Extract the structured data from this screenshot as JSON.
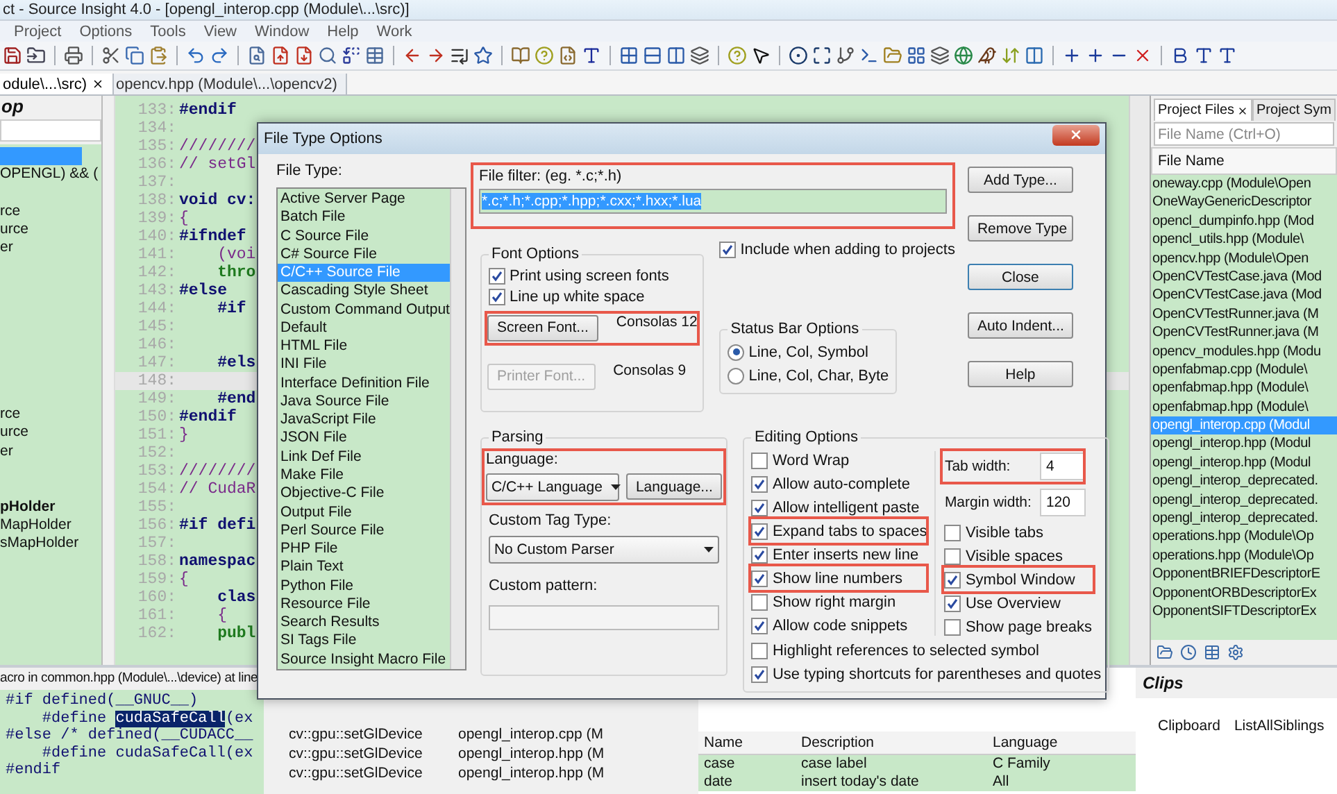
{
  "window": {
    "title": "ct - Source Insight 4.0 - [opengl_interop.cpp (Module\\...\\src)]"
  },
  "menu": [
    "Project",
    "Options",
    "Tools",
    "View",
    "Window",
    "Help",
    "Work"
  ],
  "tabs": [
    {
      "label": "odule\\...\\src)",
      "selected": true,
      "closable": true
    },
    {
      "label": "opencv.hpp (Module\\...\\opencv2)",
      "selected": false,
      "closable": false
    }
  ],
  "symbol_panel": {
    "title": "op",
    "items": [
      {
        "selected": true
      },
      {
        "text": "OPENGL) && (",
        "selected": false,
        "bold": false
      },
      {
        "selected": false
      },
      {
        "text": "rce",
        "selected": false,
        "bold": false
      },
      {
        "text": "urce",
        "selected": false,
        "bold": false
      },
      {
        "text": "er",
        "selected": false,
        "bold": false
      },
      {
        "selected": false
      },
      {
        "selected": false
      },
      {
        "selected": false
      },
      {
        "selected": false
      },
      {
        "selected": false
      },
      {
        "selected": false
      },
      {
        "selected": false
      },
      {
        "selected": false
      },
      {
        "text": "rce",
        "selected": false,
        "bold": false
      },
      {
        "text": "urce",
        "selected": false,
        "bold": false
      },
      {
        "text": "er",
        "selected": false,
        "bold": false
      },
      {
        "selected": false
      },
      {
        "selected": false
      },
      {
        "text": "pHolder",
        "selected": false,
        "bold": true
      },
      {
        "text": "MapHolder",
        "selected": false,
        "bold": false
      },
      {
        "text": "sMapHolder",
        "selected": false,
        "bold": false
      }
    ]
  },
  "editor": {
    "lines": [
      {
        "number": "133:",
        "text": "#endif",
        "kind": "directive",
        "current": false
      },
      {
        "number": "134:",
        "current": false
      },
      {
        "number": "135:",
        "text": "////////",
        "kind": "comment",
        "current": false
      },
      {
        "number": "136:",
        "text": "// setGl",
        "kind": "comment",
        "current": false
      },
      {
        "number": "137:",
        "current": false
      },
      {
        "number": "138:",
        "text": "void cv:",
        "kind": "declaration",
        "current": false
      },
      {
        "number": "139:",
        "text": "{",
        "kind": "brace",
        "current": false
      },
      {
        "number": "140:",
        "text": "#ifndef",
        "kind": "directive",
        "current": false
      },
      {
        "number": "141:",
        "text": "    (voi",
        "kind": "comment",
        "current": false
      },
      {
        "number": "142:",
        "text": "    thro",
        "kind": "keyword",
        "current": false
      },
      {
        "number": "143:",
        "text": "#else",
        "kind": "directive",
        "current": false
      },
      {
        "number": "144:",
        "text": "    #if",
        "kind": "directive",
        "current": false
      },
      {
        "number": "145:",
        "current": false
      },
      {
        "number": "146:",
        "current": false
      },
      {
        "number": "147:",
        "text": "    #els",
        "kind": "directive",
        "current": false
      },
      {
        "number": "148:",
        "current": true
      },
      {
        "number": "149:",
        "text": "    #end",
        "kind": "directive",
        "current": false
      },
      {
        "number": "150:",
        "text": "#endif",
        "kind": "directive",
        "current": false
      },
      {
        "number": "151:",
        "text": "}",
        "kind": "brace",
        "current": false
      },
      {
        "number": "152:",
        "current": false
      },
      {
        "number": "153:",
        "text": "////////",
        "kind": "comment",
        "current": false
      },
      {
        "number": "154:",
        "text": "// CudaR",
        "kind": "comment",
        "current": false
      },
      {
        "number": "155:",
        "current": false
      },
      {
        "number": "156:",
        "text": "#if defi",
        "kind": "directive",
        "current": false
      },
      {
        "number": "157:",
        "current": false
      },
      {
        "number": "158:",
        "text": "namespac",
        "kind": "declaration",
        "current": false
      },
      {
        "number": "159:",
        "text": "{",
        "kind": "brace",
        "current": false
      },
      {
        "number": "160:",
        "text": "    clas",
        "kind": "declaration",
        "current": false
      },
      {
        "number": "161:",
        "text": "    {",
        "kind": "brace",
        "current": false
      },
      {
        "number": "162:",
        "text": "    publ",
        "kind": "keyword",
        "current": false
      }
    ]
  },
  "project_panel": {
    "tabs": [
      {
        "label": "Project Files",
        "selected": true,
        "closable": true
      },
      {
        "label": "Project Sym",
        "selected": false,
        "closable": false
      }
    ],
    "search": {
      "placeholder": "File Name (Ctrl+O)"
    },
    "column": "File Name",
    "files": [
      {
        "name": "oneway.cpp (Module\\Open",
        "selected": false
      },
      {
        "name": "OneWayGenericDescriptor",
        "selected": false
      },
      {
        "name": "opencl_dumpinfo.hpp (Mod",
        "selected": false
      },
      {
        "name": "opencl_utils.hpp (Module\\",
        "selected": false
      },
      {
        "name": "opencv.hpp (Module\\Open",
        "selected": false
      },
      {
        "name": "OpenCVTestCase.java (Mod",
        "selected": false
      },
      {
        "name": "OpenCVTestCase.java (Mod",
        "selected": false
      },
      {
        "name": "OpenCVTestRunner.java (M",
        "selected": false
      },
      {
        "name": "OpenCVTestRunner.java (M",
        "selected": false
      },
      {
        "name": "opencv_modules.hpp (Modu",
        "selected": false
      },
      {
        "name": "openfabmap.cpp (Module\\",
        "selected": false
      },
      {
        "name": "openfabmap.hpp (Module\\",
        "selected": false
      },
      {
        "name": "openfabmap.hpp (Module\\",
        "selected": false
      },
      {
        "name": "opengl_interop.cpp (Modul",
        "selected": true
      },
      {
        "name": "opengl_interop.hpp (Modul",
        "selected": false
      },
      {
        "name": "opengl_interop.hpp (Modul",
        "selected": false
      },
      {
        "name": "opengl_interop_deprecated.",
        "selected": false
      },
      {
        "name": "opengl_interop_deprecated.",
        "selected": false
      },
      {
        "name": "opengl_interop_deprecated.",
        "selected": false
      },
      {
        "name": "operations.hpp (Module\\Op",
        "selected": false
      },
      {
        "name": "operations.hpp (Module\\Op",
        "selected": false
      },
      {
        "name": "OpponentBRIEFDescriptorE",
        "selected": false
      },
      {
        "name": "OpponentORBDescriptorEx",
        "selected": false
      },
      {
        "name": "OpponentSIFTDescriptorEx",
        "selected": false
      }
    ]
  },
  "context": {
    "title": "acro in common.hpp (Module\\...\\device) at line",
    "lines": [
      [
        {
          "text": "#if defined(__GNUC__)",
          "selected": false
        }
      ],
      [
        {
          "text": "    #define ",
          "selected": false
        },
        {
          "text": "cudaSafeCall",
          "selected": true
        },
        {
          "text": "(ex",
          "selected": false
        }
      ],
      [
        {
          "text": "#else /* defined(__CUDACC__",
          "selected": false
        }
      ],
      [
        {
          "text": "    #define cudaSafeCall(ex",
          "selected": false
        }
      ],
      [
        {
          "text": "#endif",
          "selected": false
        }
      ]
    ]
  },
  "relations": [
    {
      "symbol": "cv::gpu::setGlDevice",
      "file": "opengl_interop.cpp (M"
    },
    {
      "symbol": "cv::gpu::setGlDevice",
      "file": "opengl_interop.hpp (M"
    },
    {
      "symbol": "cv::gpu::setGlDevice",
      "file": "opengl_interop.hpp (M"
    }
  ],
  "clip_table": {
    "columns": [
      "Name",
      "Description",
      "Language"
    ],
    "rows": [
      [
        "case",
        "case label",
        "C Family"
      ],
      [
        "date",
        "insert today's date",
        "All"
      ]
    ]
  },
  "clips": {
    "title": "Clips",
    "items": [
      "Clipboard",
      "ListAllSiblings"
    ]
  },
  "dialog": {
    "title": "File Type Options",
    "file_type_label": "File Type:",
    "file_types": [
      {
        "name": "Active Server Page",
        "selected": false
      },
      {
        "name": "Batch File",
        "selected": false
      },
      {
        "name": "C Source File",
        "selected": false
      },
      {
        "name": "C# Source File",
        "selected": false
      },
      {
        "name": "C/C++ Source File",
        "selected": true
      },
      {
        "name": "Cascading Style Sheet",
        "selected": false
      },
      {
        "name": "Custom Command Output",
        "selected": false
      },
      {
        "name": "Default",
        "selected": false
      },
      {
        "name": "HTML File",
        "selected": false
      },
      {
        "name": "INI File",
        "selected": false
      },
      {
        "name": "Interface Definition File",
        "selected": false
      },
      {
        "name": "Java Source File",
        "selected": false
      },
      {
        "name": "JavaScript File",
        "selected": false
      },
      {
        "name": "JSON File",
        "selected": false
      },
      {
        "name": "Link Def File",
        "selected": false
      },
      {
        "name": "Make File",
        "selected": false
      },
      {
        "name": "Objective-C File",
        "selected": false
      },
      {
        "name": "Output File",
        "selected": false
      },
      {
        "name": "Perl Source File",
        "selected": false
      },
      {
        "name": "PHP File",
        "selected": false
      },
      {
        "name": "Plain Text",
        "selected": false
      },
      {
        "name": "Python File",
        "selected": false
      },
      {
        "name": "Resource File",
        "selected": false
      },
      {
        "name": "Search Results",
        "selected": false
      },
      {
        "name": "SI Tags File",
        "selected": false
      },
      {
        "name": "Source Insight Macro File",
        "selected": false
      }
    ],
    "file_filter": {
      "label": "File filter: (eg. *.c;*.h)",
      "value": "*.c;*.h;*.cpp;*.hpp;*.cxx;*.hxx;*.lua",
      "annotated": true
    },
    "buttons": [
      {
        "label": "Add Type...",
        "default": false
      },
      {
        "label": "Remove Type",
        "default": false
      },
      {
        "label": "Close",
        "default": true
      },
      {
        "label": "Auto Indent...",
        "default": false
      },
      {
        "label": "Help",
        "default": false
      }
    ],
    "font_options": {
      "title": "Font Options",
      "checks": [
        {
          "label": "Print using screen fonts",
          "checked": true
        },
        {
          "label": "Line up white space",
          "checked": true
        }
      ],
      "fonts": [
        {
          "button": "Screen Font...",
          "value": "Consolas 12",
          "disabled": false,
          "annotated": true
        },
        {
          "button": "Printer Font...",
          "value": "Consolas 9",
          "disabled": true,
          "annotated": false
        }
      ]
    },
    "include_in_projects": {
      "label": "Include when adding to projects",
      "checked": true
    },
    "status_bar": {
      "title": "Status Bar Options",
      "options": [
        {
          "label": "Line, Col, Symbol",
          "selected": true
        },
        {
          "label": "Line, Col, Char, Byte",
          "selected": false
        }
      ]
    },
    "parsing": {
      "title": "Parsing",
      "language_label": "Language:",
      "language": "C/C++ Language",
      "language_button": "Language...",
      "annotated": true,
      "tag_label": "Custom Tag Type:",
      "tag": "No Custom Parser",
      "pattern_label": "Custom pattern:"
    },
    "editing": {
      "title": "Editing Options",
      "left": [
        {
          "label": "Word Wrap",
          "checked": false,
          "annotated": false
        },
        {
          "label": "Allow auto-complete",
          "checked": true,
          "annotated": false
        },
        {
          "label": "Allow intelligent paste",
          "checked": true,
          "annotated": false
        },
        {
          "label": "Expand tabs to spaces",
          "checked": true,
          "annotated": true
        },
        {
          "label": "Enter inserts new line",
          "checked": true,
          "annotated": false
        },
        {
          "label": "Show line numbers",
          "checked": true,
          "annotated": true
        },
        {
          "label": "Show right margin",
          "checked": false,
          "annotated": false
        },
        {
          "label": "Allow code snippets",
          "checked": true,
          "annotated": false
        }
      ],
      "fields": [
        {
          "label": "Tab width:",
          "value": "4",
          "annotated": true
        },
        {
          "label": "Margin width:",
          "value": "120",
          "annotated": false
        }
      ],
      "right": [
        {
          "label": "Visible tabs",
          "checked": false,
          "annotated": false
        },
        {
          "label": "Visible spaces",
          "checked": false,
          "annotated": false
        },
        {
          "label": "Symbol Window",
          "checked": true,
          "annotated": true
        },
        {
          "label": "Use Overview",
          "checked": true,
          "annotated": false
        },
        {
          "label": "Show page breaks",
          "checked": false,
          "annotated": false
        }
      ],
      "wide": [
        {
          "label": "Highlight references to selected symbol",
          "checked": false,
          "annotated": false
        },
        {
          "label": "Use typing shortcuts for parentheses and quotes",
          "checked": true,
          "annotated": false
        }
      ]
    }
  }
}
